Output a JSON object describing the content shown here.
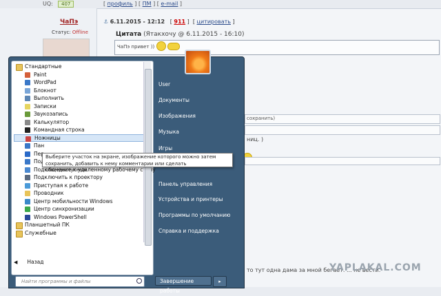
{
  "forum": {
    "top": {
      "uq_label": "UQ:",
      "uq_value": "407",
      "profile": "профиль",
      "pm": "ПМ",
      "email": "e-mail"
    },
    "post": {
      "nick": "ЧаПэ",
      "status_label": "Статус:",
      "status_value": "Offline",
      "date": "6.11.2015 - 12:12",
      "num": "911",
      "cite": "цитировать",
      "quote_title": "Цитата",
      "quote_meta": "(Ятакхочу @ 6.11.2015 - 16:10)",
      "quote_text": "ЧаПэ привет ))"
    },
    "bg_texts": {
      "saved": "сохранить)",
      "hint": "ниц. )",
      "bottom": "то тут одна дама за мной бегает. ... не вести."
    },
    "watermark": "YAPLAKAL.COM"
  },
  "startmenu": {
    "programs": [
      {
        "label": "Стандартные",
        "kind": "folder",
        "color": "#e8c45a"
      },
      {
        "label": "Paint",
        "kind": "sub",
        "color": "#d4603a"
      },
      {
        "label": "WordPad",
        "kind": "sub",
        "color": "#3a78c8"
      },
      {
        "label": "Блокнот",
        "kind": "sub",
        "color": "#7aa6d8"
      },
      {
        "label": "Выполнить",
        "kind": "sub",
        "color": "#5d87b5"
      },
      {
        "label": "Записки",
        "kind": "sub",
        "color": "#e6d560"
      },
      {
        "label": "Звукозапись",
        "kind": "sub",
        "color": "#6a9a3a"
      },
      {
        "label": "Калькулятор",
        "kind": "sub",
        "color": "#8a8a8a"
      },
      {
        "label": "Командная строка",
        "kind": "sub",
        "color": "#222222"
      },
      {
        "label": "Ножницы",
        "kind": "sub",
        "color": "#c44",
        "selected": true
      },
      {
        "label": "Пан",
        "kind": "sub",
        "color": "#3a78c8"
      },
      {
        "label": "Пер",
        "kind": "sub",
        "color": "#2a6ac8"
      },
      {
        "label": "Подключение к сетевому проектору",
        "kind": "sub",
        "color": "#3a78c8"
      },
      {
        "label": "Подключение к удаленному рабочему столу",
        "kind": "sub",
        "color": "#4a88d0"
      },
      {
        "label": "Подключить к проектору",
        "kind": "sub",
        "color": "#5a6a80"
      },
      {
        "label": "Приступая к работе",
        "kind": "sub",
        "color": "#4a9ad8"
      },
      {
        "label": "Проводник",
        "kind": "sub",
        "color": "#e8c45a"
      },
      {
        "label": "Центр мобильности Windows",
        "kind": "sub",
        "color": "#3a88c8"
      },
      {
        "label": "Центр синхронизации",
        "kind": "sub",
        "color": "#3aa84a"
      },
      {
        "label": "Windows PowerShell",
        "kind": "sub",
        "color": "#2a4a9a"
      },
      {
        "label": "Планшетный ПК",
        "kind": "folder",
        "color": "#e8c45a"
      },
      {
        "label": "Служебные",
        "kind": "folder",
        "color": "#e8c45a"
      }
    ],
    "back": "Назад",
    "search_placeholder": "Найти программы и файлы",
    "right_items": [
      "User",
      "Документы",
      "Изображения",
      "Музыка",
      "Игры",
      "Компьютер",
      "Панель управления",
      "Устройства и принтеры",
      "Программы по умолчанию",
      "Справка и поддержка"
    ],
    "shutdown": "Завершение работы",
    "tooltip": "Выберите участок на экране, изображение которого можно затем сохранить, добавить к нему комментарии или сделать общедоступным."
  }
}
